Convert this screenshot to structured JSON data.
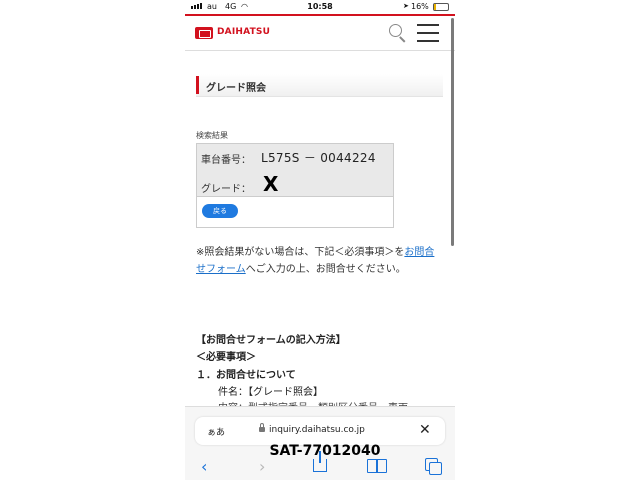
{
  "status_bar": {
    "carrier": "au",
    "network": "4G",
    "time": "10:58",
    "battery": "16%",
    "battery_level": 0.16
  },
  "header": {
    "brand": "DAIHATSU"
  },
  "page": {
    "heading": "グレード照会",
    "section_label": "検索結果",
    "chassis_label": "車台番号：",
    "chassis_value": "L575S － 0044224",
    "grade_label": "グレード：",
    "grade_value": "X",
    "back_button": "戻る",
    "note_prefix": "※照会結果がない場合は、下記＜必須事項＞を",
    "note_link": "お問合せフォーム",
    "note_suffix": "へご入力の上、お問合せください。",
    "how_title": "【お問合せフォームの記入方法】",
    "required_title": "＜必要事項＞",
    "item1_title": "１．お問合せについて",
    "item1_subject": "件名：【グレード照会】",
    "item1_content": "内容：型式指定番号、類別区分番号、車両"
  },
  "browser": {
    "text_size": "ぁあ",
    "url": "inquiry.daihatsu.co.jp",
    "overlay_code": "SAT-77012040"
  },
  "colors": {
    "brand_red": "#d2111e",
    "link_blue": "#1b6fc9",
    "button_blue": "#1f7ae0",
    "toolbar_blue": "#1a72d8"
  },
  "icons": [
    "search-icon",
    "menu-icon",
    "lock-icon",
    "close-icon",
    "back-arrow-icon",
    "forward-arrow-icon",
    "share-icon",
    "bookmarks-icon",
    "tabs-icon"
  ]
}
